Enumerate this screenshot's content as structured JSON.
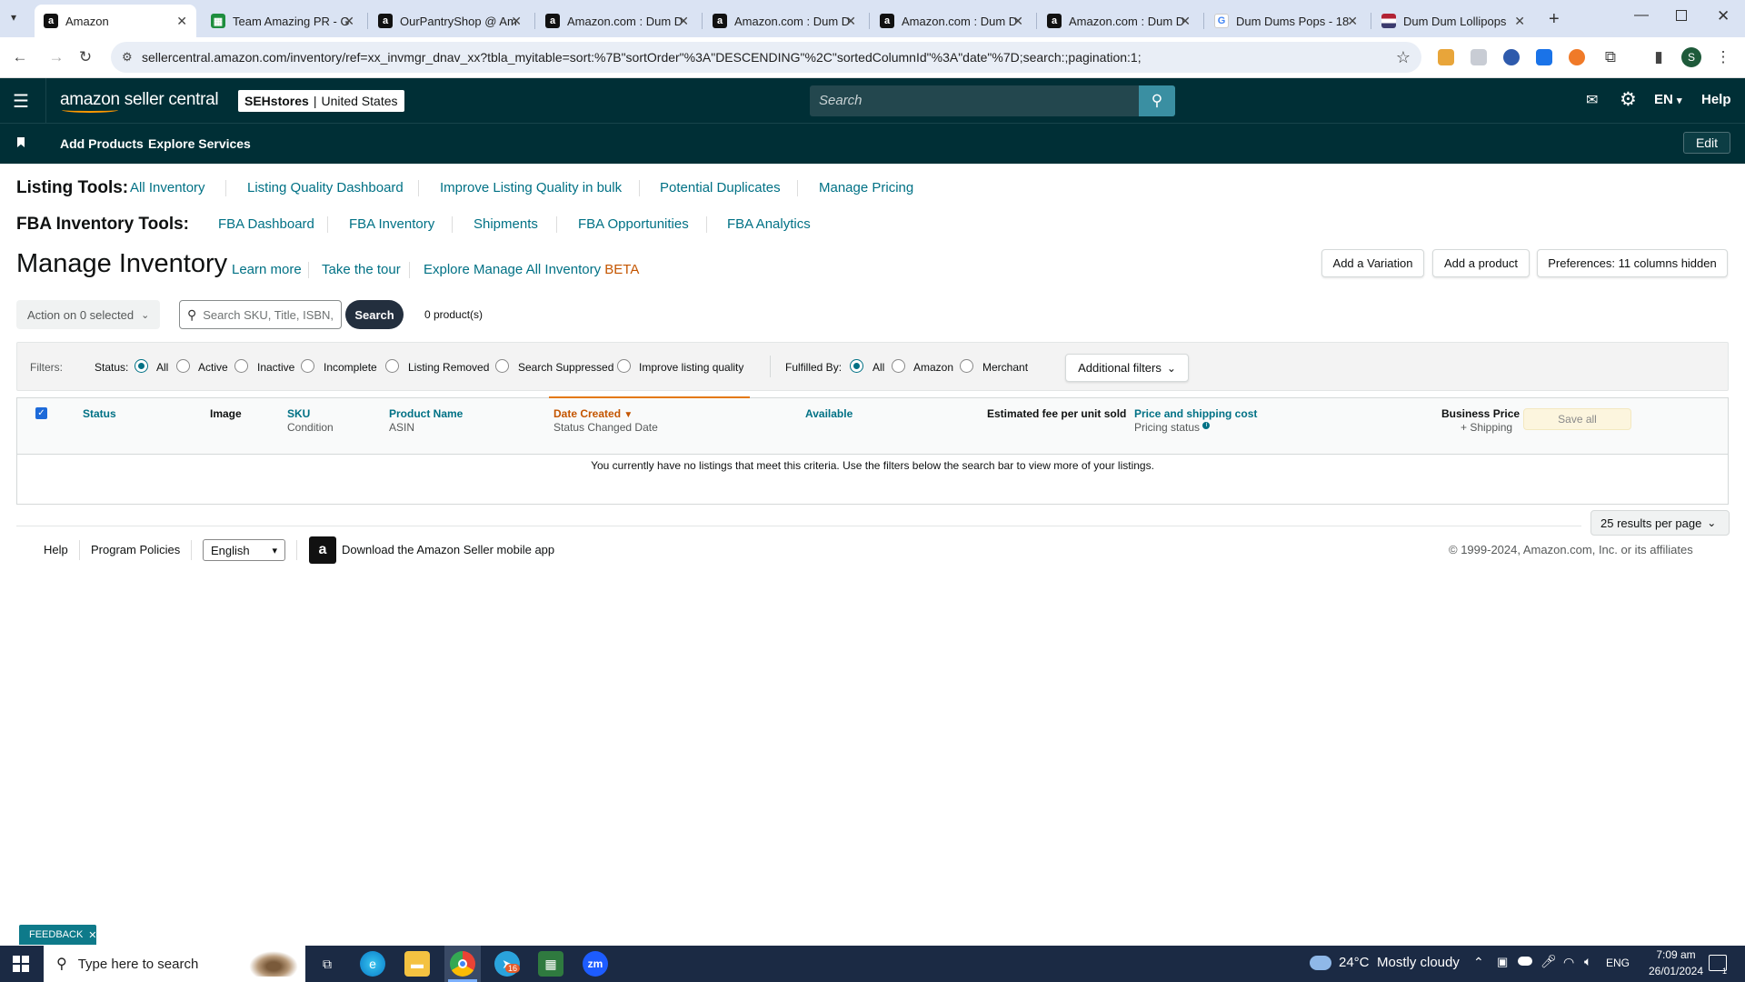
{
  "browser": {
    "tabs": [
      {
        "title": "Amazon",
        "icon": "amazon-icon"
      },
      {
        "title": "Team Amazing PR - G",
        "icon": "sheets-icon"
      },
      {
        "title": "OurPantryShop @ Am",
        "icon": "amazon-icon"
      },
      {
        "title": "Amazon.com : Dum D",
        "icon": "amazon-icon"
      },
      {
        "title": "Amazon.com : Dum D",
        "icon": "amazon-icon"
      },
      {
        "title": "Amazon.com : Dum D",
        "icon": "amazon-icon"
      },
      {
        "title": "Amazon.com : Dum D",
        "icon": "amazon-icon"
      },
      {
        "title": "Dum Dums Pops - 18",
        "icon": "google-icon"
      },
      {
        "title": "Dum Dum Lollipops",
        "icon": "flag-icon"
      }
    ],
    "url": "sellercentral.amazon.com/inventory/ref=xx_invmgr_dnav_xx?tbla_myitable=sort:%7B\"sortOrder\"%3A\"DESCENDING\"%2C\"sortedColumnId\"%3A\"date\"%7D;search:;pagination:1;",
    "profile_initial": "S"
  },
  "header": {
    "logo_text": "amazon seller central",
    "store": "SEHstores",
    "marketplace": "United States",
    "search_placeholder": "Search",
    "language": "EN",
    "help": "Help"
  },
  "nav": {
    "items": [
      "Add Products",
      "Explore Services"
    ],
    "edit": "Edit"
  },
  "listing_tools": {
    "label": "Listing Tools:",
    "links": [
      "All Inventory",
      "Listing Quality Dashboard",
      "Improve Listing Quality in bulk",
      "Potential Duplicates",
      "Manage Pricing"
    ]
  },
  "fba_tools": {
    "label": "FBA Inventory Tools:",
    "links": [
      "FBA Dashboard",
      "FBA Inventory",
      "Shipments",
      "FBA Opportunities",
      "FBA Analytics"
    ]
  },
  "page": {
    "title": "Manage Inventory",
    "learn_more": "Learn more",
    "take_tour": "Take the tour",
    "explore": "Explore Manage All Inventory",
    "beta": "BETA",
    "add_variation": "Add a Variation",
    "add_product": "Add a product",
    "preferences": "Preferences: 11 columns hidden"
  },
  "toolbar": {
    "action": "Action on 0 selected",
    "search_placeholder": "Search SKU, Title, ISBN,",
    "search_button": "Search",
    "count": "0 product(s)"
  },
  "filters": {
    "label": "Filters:",
    "status_label": "Status:",
    "status_options": [
      "All",
      "Active",
      "Inactive",
      "Incomplete",
      "Listing Removed",
      "Search Suppressed",
      "Improve listing quality"
    ],
    "status_selected": "All",
    "fulfilled_label": "Fulfilled By:",
    "fulfilled_options": [
      "All",
      "Amazon",
      "Merchant"
    ],
    "fulfilled_selected": "All",
    "additional": "Additional filters"
  },
  "table": {
    "headers": {
      "status": "Status",
      "image": "Image",
      "sku": "SKU",
      "condition": "Condition",
      "product_name": "Product Name",
      "asin": "ASIN",
      "date_created": "Date Created",
      "status_changed": "Status Changed Date",
      "available": "Available",
      "est_fee": "Estimated fee per unit sold",
      "price_shipping": "Price and shipping cost",
      "pricing_status": "Pricing status",
      "business_price": "Business Price",
      "plus_shipping": "+ Shipping",
      "save_all": "Save all"
    },
    "empty_message": "You currently have no listings that meet this criteria. Use the filters below the search bar to view more of your listings.",
    "per_page": "25 results per page"
  },
  "footer": {
    "help": "Help",
    "program_policies": "Program Policies",
    "language": "English",
    "download_app": "Download the Amazon Seller mobile app",
    "copyright": "© 1999-2024, Amazon.com, Inc. or its affiliates"
  },
  "feedback": "FEEDBACK",
  "taskbar": {
    "search_placeholder": "Type here to search",
    "weather_temp": "24°C",
    "weather_desc": "Mostly cloudy",
    "language": "ENG",
    "time": "7:09 am",
    "date": "26/01/2024",
    "badge": "16",
    "notification_count": "1"
  },
  "colors": {
    "header_bg": "#002f36",
    "link": "#007185",
    "accent_orange": "#c45500"
  }
}
